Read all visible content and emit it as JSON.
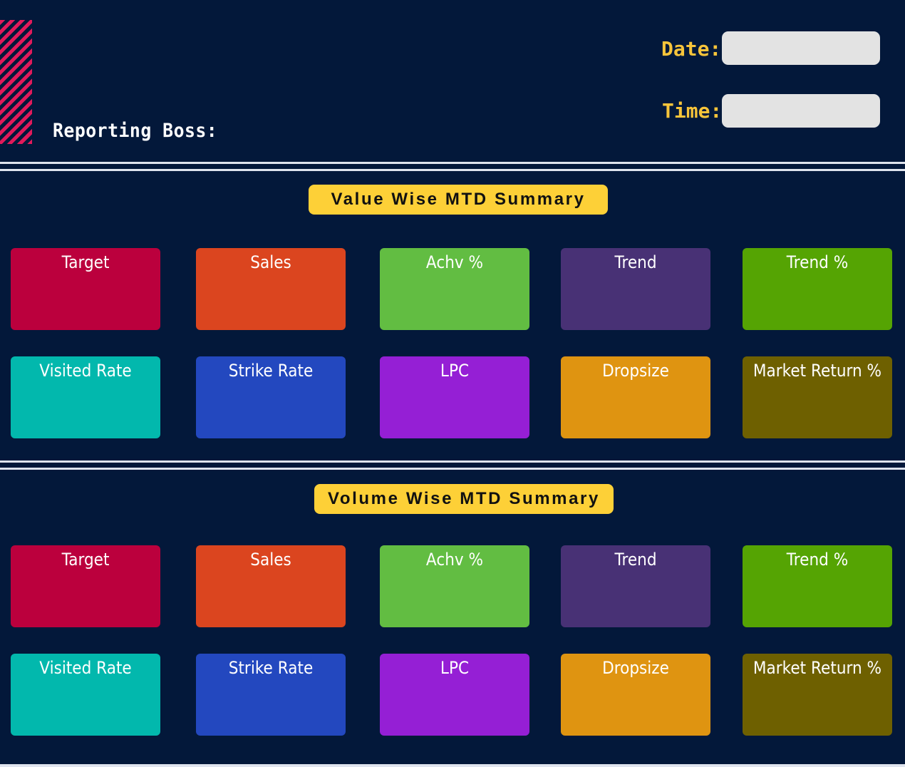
{
  "header": {
    "reporting_boss_label": "Reporting Boss:",
    "date_label": "Date:",
    "time_label": "Time:",
    "date_value": "",
    "time_value": ""
  },
  "value_section": {
    "title": "Value Wise MTD Summary",
    "cards": [
      {
        "label": "Target",
        "color": "#bb003d"
      },
      {
        "label": "Sales",
        "color": "#db451f"
      },
      {
        "label": "Achv %",
        "color": "#62bd42"
      },
      {
        "label": "Trend",
        "color": "#483175"
      },
      {
        "label": "Trend %",
        "color": "#55a403"
      },
      {
        "label": "Visited Rate",
        "color": "#02b8ad"
      },
      {
        "label": "Strike Rate",
        "color": "#2348bf"
      },
      {
        "label": "LPC",
        "color": "#951fd5"
      },
      {
        "label": "Dropsize",
        "color": "#df9411"
      },
      {
        "label": "Market Return %",
        "color": "#6e6000"
      }
    ]
  },
  "volume_section": {
    "title": "Volume Wise MTD Summary",
    "cards": [
      {
        "label": "Target",
        "color": "#bb003d"
      },
      {
        "label": "Sales",
        "color": "#db451f"
      },
      {
        "label": "Achv %",
        "color": "#62bd42"
      },
      {
        "label": "Trend",
        "color": "#483175"
      },
      {
        "label": "Trend %",
        "color": "#55a403"
      },
      {
        "label": "Visited Rate",
        "color": "#02b8ad"
      },
      {
        "label": "Strike Rate",
        "color": "#2348bf"
      },
      {
        "label": "LPC",
        "color": "#951fd5"
      },
      {
        "label": "Dropsize",
        "color": "#df9411"
      },
      {
        "label": "Market Return %",
        "color": "#6e6000"
      }
    ]
  },
  "colors": {
    "background": "#03183a",
    "accent_yellow": "#fdd037",
    "label_yellow": "#f7c43a",
    "stripe_pink": "#e11a5b"
  }
}
